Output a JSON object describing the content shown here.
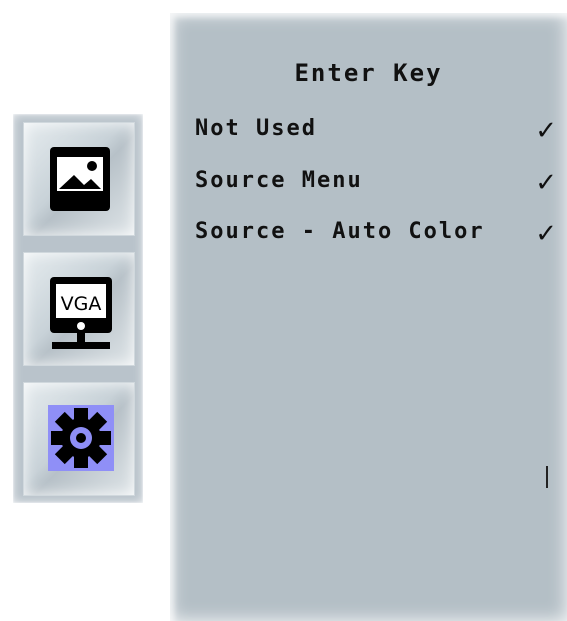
{
  "sidebar": {
    "items": [
      {
        "name": "picture",
        "icon": "picture-icon",
        "selected": false
      },
      {
        "name": "vga",
        "icon": "vga-monitor-icon",
        "icon_text": "VGA",
        "selected": false
      },
      {
        "name": "settings",
        "icon": "gear-icon",
        "selected": true
      }
    ],
    "selected_color": "#8f8ff7"
  },
  "menu": {
    "title": "Enter Key",
    "items": [
      {
        "label": "Not Used",
        "mark": "✓"
      },
      {
        "label": "Source Menu",
        "mark": "✓"
      },
      {
        "label": "Source - Auto Color",
        "mark": "✓"
      }
    ]
  }
}
